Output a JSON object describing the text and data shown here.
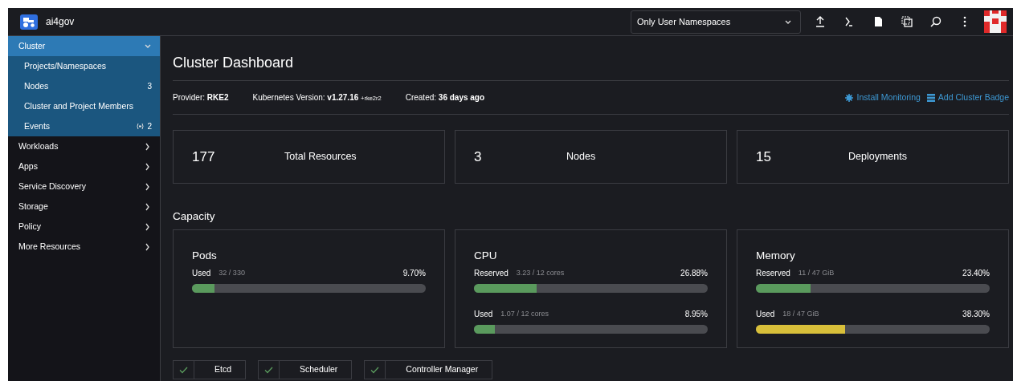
{
  "header": {
    "app_name": "ai4gov",
    "namespace_filter": {
      "value": "Only User Namespaces"
    }
  },
  "sidebar": {
    "groups": [
      {
        "label": "Cluster",
        "expanded": true,
        "children": [
          {
            "label": "Projects/Namespaces"
          },
          {
            "label": "Nodes",
            "count": "3",
            "kind": "plain"
          },
          {
            "label": "Cluster and Project Members"
          },
          {
            "label": "Events",
            "count": "2",
            "kind": "live"
          }
        ]
      },
      {
        "label": "Workloads",
        "expanded": false
      },
      {
        "label": "Apps",
        "expanded": false
      },
      {
        "label": "Service Discovery",
        "expanded": false
      },
      {
        "label": "Storage",
        "expanded": false
      },
      {
        "label": "Policy",
        "expanded": false
      },
      {
        "label": "More Resources",
        "expanded": false
      }
    ]
  },
  "page": {
    "title": "Cluster Dashboard",
    "meta": [
      {
        "label": "Provider:",
        "value": "RKE2"
      },
      {
        "label": "Kubernetes Version:",
        "value": "v1.27.16",
        "suffix": "+rke2r2"
      },
      {
        "label": "Created:",
        "value": "36 days ago"
      }
    ],
    "actions": [
      {
        "label": "Install Monitoring",
        "kind": "gear"
      },
      {
        "label": "Add Cluster Badge",
        "kind": "badge"
      }
    ],
    "stats": [
      {
        "count": "177",
        "name": "Total Resources"
      },
      {
        "count": "3",
        "name": "Nodes"
      },
      {
        "count": "15",
        "name": "Deployments"
      }
    ],
    "capacity_title": "Capacity",
    "capacity": [
      {
        "title": "Pods",
        "meters": [
          {
            "label": "Used",
            "detail": "32 / 330",
            "reading": "9.70%",
            "level": 0.097,
            "color": "#5a9a5d"
          }
        ]
      },
      {
        "title": "CPU",
        "meters": [
          {
            "label": "Reserved",
            "detail": "3.23 / 12 cores",
            "reading": "26.88%",
            "level": 0.2688,
            "color": "#5a9a5d"
          },
          {
            "label": "Used",
            "detail": "1.07 / 12 cores",
            "reading": "8.95%",
            "level": 0.0895,
            "color": "#5a9a5d"
          }
        ]
      },
      {
        "title": "Memory",
        "meters": [
          {
            "label": "Reserved",
            "detail": "11 / 47 GiB",
            "reading": "23.40%",
            "level": 0.234,
            "color": "#5a9a5d"
          },
          {
            "label": "Used",
            "detail": "18 / 47 GiB",
            "reading": "38.30%",
            "level": 0.383,
            "color": "#d8bf3a"
          }
        ]
      }
    ],
    "components": [
      {
        "label": "Etcd",
        "healthy": true
      },
      {
        "label": "Scheduler",
        "healthy": true
      },
      {
        "label": "Controller Manager",
        "healthy": true
      }
    ]
  }
}
